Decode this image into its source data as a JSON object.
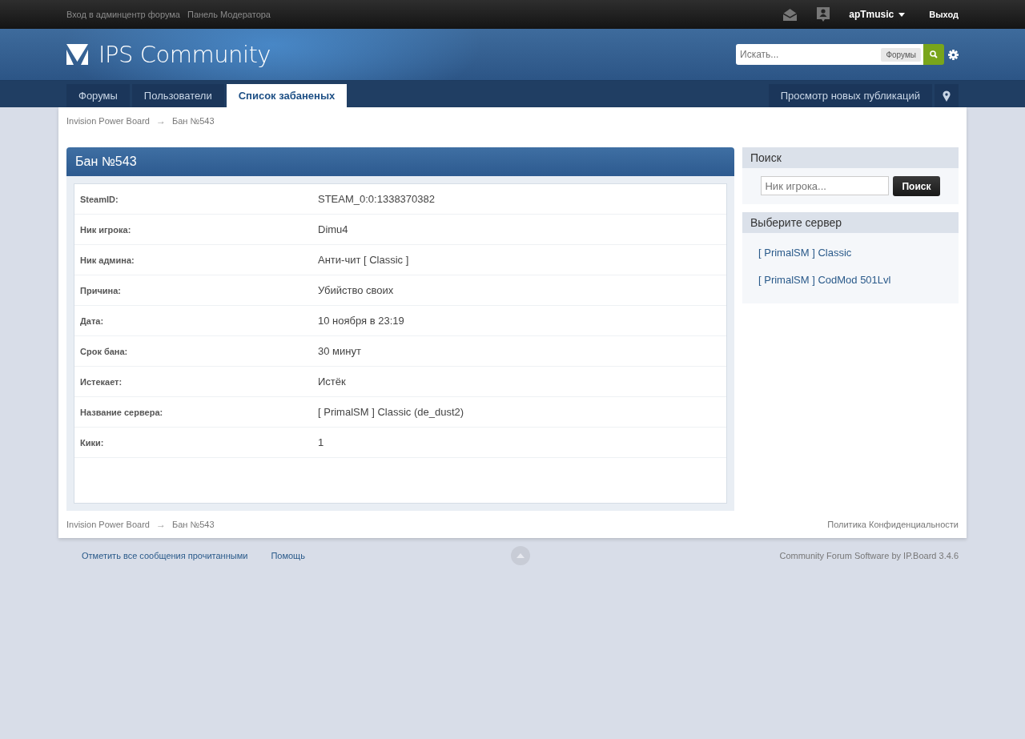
{
  "top_bar": {
    "links": [
      "Вход в админцентр форума",
      "Панель Модератора"
    ],
    "user": "apTmusic",
    "logout": "Выход"
  },
  "header": {
    "logo": "IPS Community",
    "search": {
      "placeholder": "Искать...",
      "scope": "Форумы"
    }
  },
  "nav": {
    "tabs": [
      {
        "label": "Форумы",
        "selected": false
      },
      {
        "label": "Пользователи",
        "selected": false
      },
      {
        "label": "Список забаненых",
        "selected": true
      }
    ],
    "new_posts": "Просмотр новых публикаций"
  },
  "breadcrumb": [
    "Invision Power Board",
    "→",
    "Бан №543"
  ],
  "ban": {
    "title": "Бан №543",
    "rows": [
      {
        "label": "SteamID:",
        "value": "STEAM_0:0:1338370382"
      },
      {
        "label": "Ник игрока:",
        "value": "Dimu4"
      },
      {
        "label": "Ник админа:",
        "value": "Анти-чит [ Classic ]"
      },
      {
        "label": "Причина:",
        "value": "Убийство своих"
      },
      {
        "label": "Дата:",
        "value": "10 ноября в 23:19"
      },
      {
        "label": "Срок бана:",
        "value": "30 минут"
      },
      {
        "label": "Истекает:",
        "value": "Истёк"
      },
      {
        "label": "Название сервера:",
        "value": "[ PrimalSM ] Classic (de_dust2)"
      },
      {
        "label": "Кики:",
        "value": "1"
      }
    ]
  },
  "sidebar": {
    "search": {
      "title": "Поиск",
      "placeholder": "Ник игрока...",
      "button": "Поиск"
    },
    "servers": {
      "title": "Выберите сервер",
      "items": [
        "[ PrimalSM ] Classic",
        "[ PrimalSM ] CodMod 501Lvl"
      ]
    }
  },
  "footer_breadcrumb": [
    "Invision Power Board",
    "→",
    "Бан №543"
  ],
  "privacy": "Политика Конфиденциальности",
  "bottom": {
    "links": [
      "Отметить все сообщения прочитанными",
      "Помощь"
    ],
    "credit": "Community Forum Software by IP.Board 3.4.6"
  }
}
